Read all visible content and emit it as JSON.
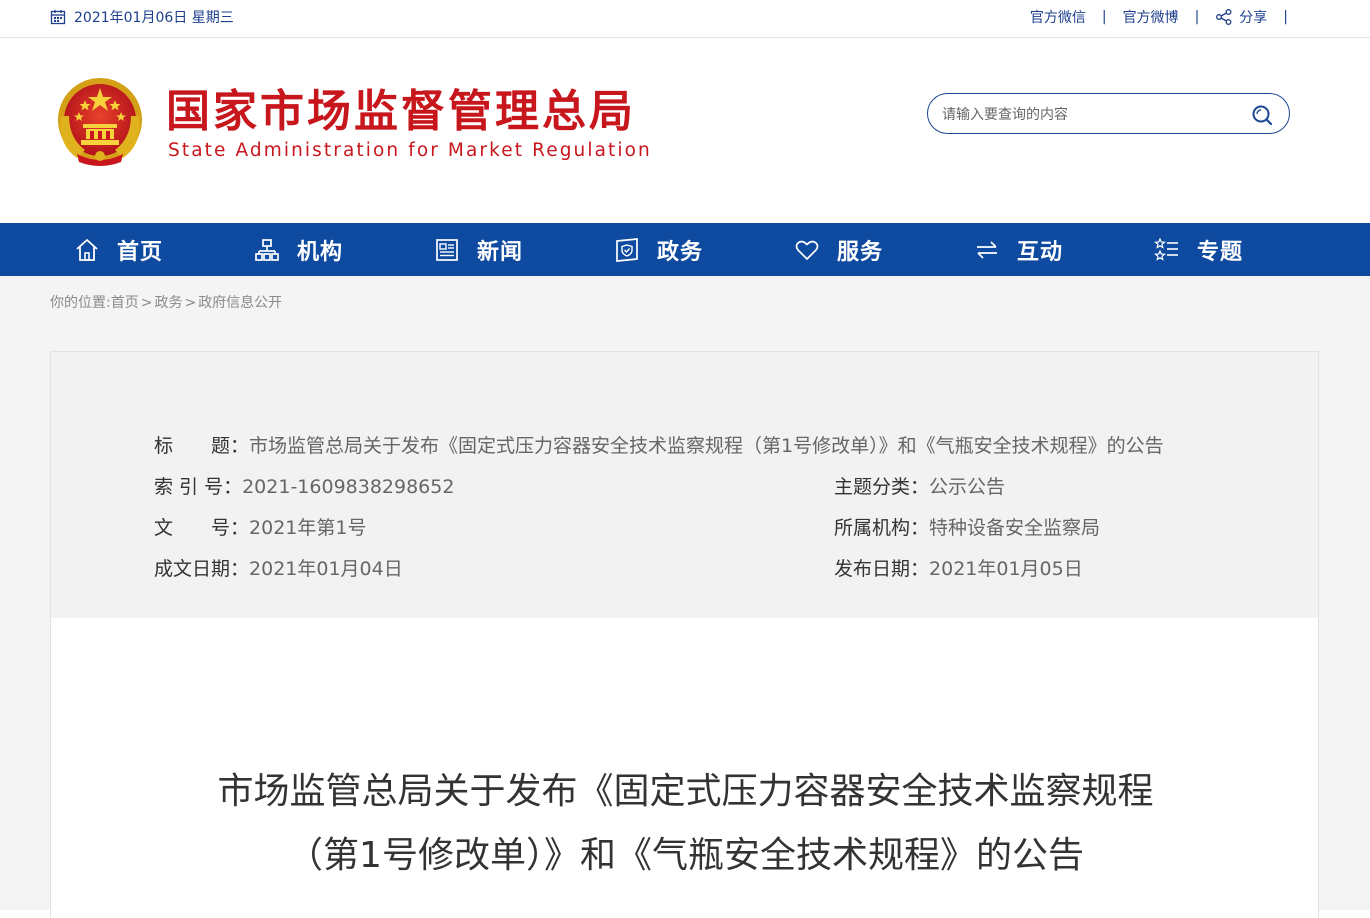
{
  "topbar": {
    "date": "2021年01月06日 星期三",
    "links": [
      "官方微信",
      "官方微博",
      "分享"
    ],
    "separator": "|"
  },
  "header": {
    "logo_cn": "国家市场监督管理总局",
    "logo_en": "State Administration for Market Regulation",
    "search_placeholder": "请输入要查询的内容"
  },
  "nav": [
    {
      "label": "首页",
      "icon": "home-icon"
    },
    {
      "label": "机构",
      "icon": "org-chart-icon"
    },
    {
      "label": "新闻",
      "icon": "newspaper-icon"
    },
    {
      "label": "政务",
      "icon": "document-shield-icon"
    },
    {
      "label": "服务",
      "icon": "heart-icon"
    },
    {
      "label": "互动",
      "icon": "exchange-arrows-icon"
    },
    {
      "label": "专题",
      "icon": "star-list-icon"
    }
  ],
  "breadcrumb": {
    "prefix": "你的位置:",
    "items": [
      "首页",
      "政务",
      "政府信息公开"
    ],
    "arrow": ">"
  },
  "info": {
    "title_key": "标　　题：",
    "title_val": "市场监管总局关于发布《固定式压力容器安全技术监察规程（第1号修改单）》和《气瓶安全技术规程》的公告",
    "index_key": "索 引 号：",
    "index_val": "2021-1609838298652",
    "topic_key": "主题分类：",
    "topic_val": "公示公告",
    "docno_key": "文　　号：",
    "docno_val": "2021年第1号",
    "org_key": "所属机构：",
    "org_val": "特种设备安全监察局",
    "created_key": "成文日期：",
    "created_val": "2021年01月04日",
    "published_key": "发布日期：",
    "published_val": "2021年01月05日"
  },
  "article": {
    "title_line1": "市场监管总局关于发布《固定式压力容器安全技术监察规程",
    "title_line2": "（第1号修改单）》和《气瓶安全技术规程》的公告"
  },
  "colors": {
    "nav_bg": "#0e4a9f",
    "brand_red": "#c8161d",
    "link_blue": "#1d3f8c"
  }
}
